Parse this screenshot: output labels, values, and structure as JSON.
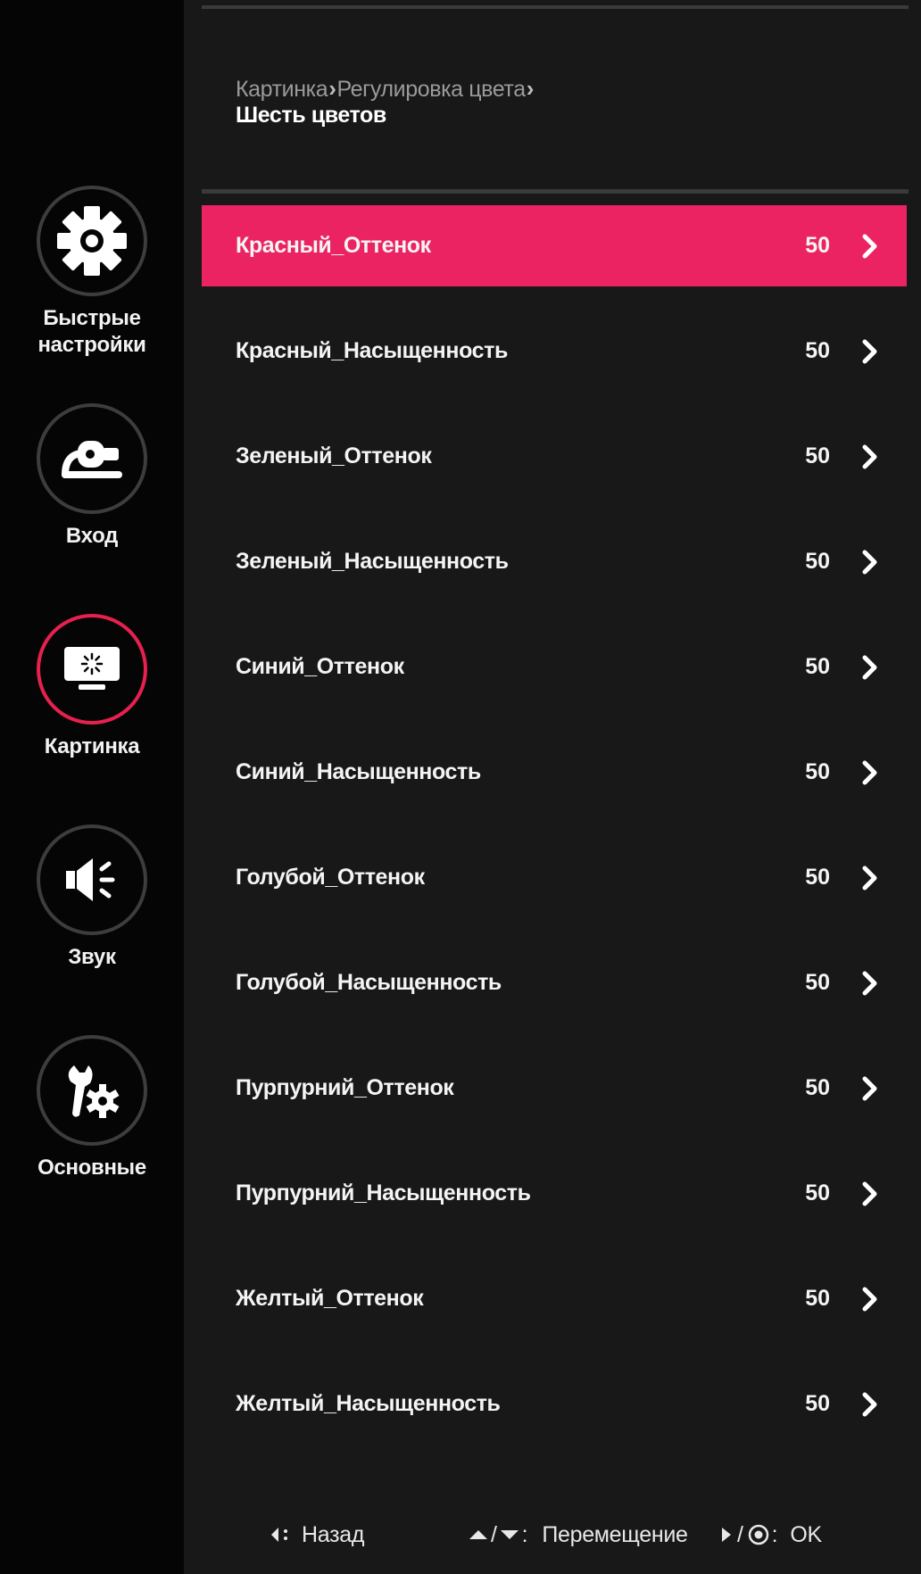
{
  "sidebar": {
    "items": [
      {
        "id": "quick-settings",
        "label": "Быстрые\nнастройки",
        "icon": "gear-icon",
        "active": false
      },
      {
        "id": "input",
        "label": "Вход",
        "icon": "input-plug-icon",
        "active": false
      },
      {
        "id": "picture",
        "label": "Картинка",
        "icon": "monitor-brightness-icon",
        "active": true
      },
      {
        "id": "sound",
        "label": "Звук",
        "icon": "speaker-icon",
        "active": false
      },
      {
        "id": "general",
        "label": "Основные",
        "icon": "wrench-gear-icon",
        "active": false
      }
    ]
  },
  "breadcrumb": {
    "level1": "Картинка",
    "level2": "Регулировка цвета",
    "current": "Шесть цветов"
  },
  "menu": {
    "selected_index": 0,
    "items": [
      {
        "label": "Красный_Оттенок",
        "value": "50"
      },
      {
        "label": "Красный_Насыщенность",
        "value": "50"
      },
      {
        "label": "Зеленый_Оттенок",
        "value": "50"
      },
      {
        "label": "Зеленый_Насыщенность",
        "value": "50"
      },
      {
        "label": "Синий_Оттенок",
        "value": "50"
      },
      {
        "label": "Синий_Насыщенность",
        "value": "50"
      },
      {
        "label": "Голубой_Оттенок",
        "value": "50"
      },
      {
        "label": "Голубой_Насыщенность",
        "value": "50"
      },
      {
        "label": "Пурпурний_Оттенок",
        "value": "50"
      },
      {
        "label": "Пурпурний_Насыщенность",
        "value": "50"
      },
      {
        "label": "Желтый_Оттенок",
        "value": "50"
      },
      {
        "label": "Желтый_Насыщенность",
        "value": "50"
      }
    ]
  },
  "footer": {
    "back_label": "Назад",
    "move_label": "Перемещение",
    "ok_label": "OK",
    "back_key_icon": "left-arrow-icon",
    "move_key_icons": [
      "up-arrow-icon",
      "down-arrow-icon"
    ],
    "ok_key_icons": [
      "right-arrow-icon",
      "joystick-press-icon"
    ]
  },
  "colors": {
    "accent": "#ec2363",
    "background": "#181818",
    "sidebar_background": "#050505"
  }
}
